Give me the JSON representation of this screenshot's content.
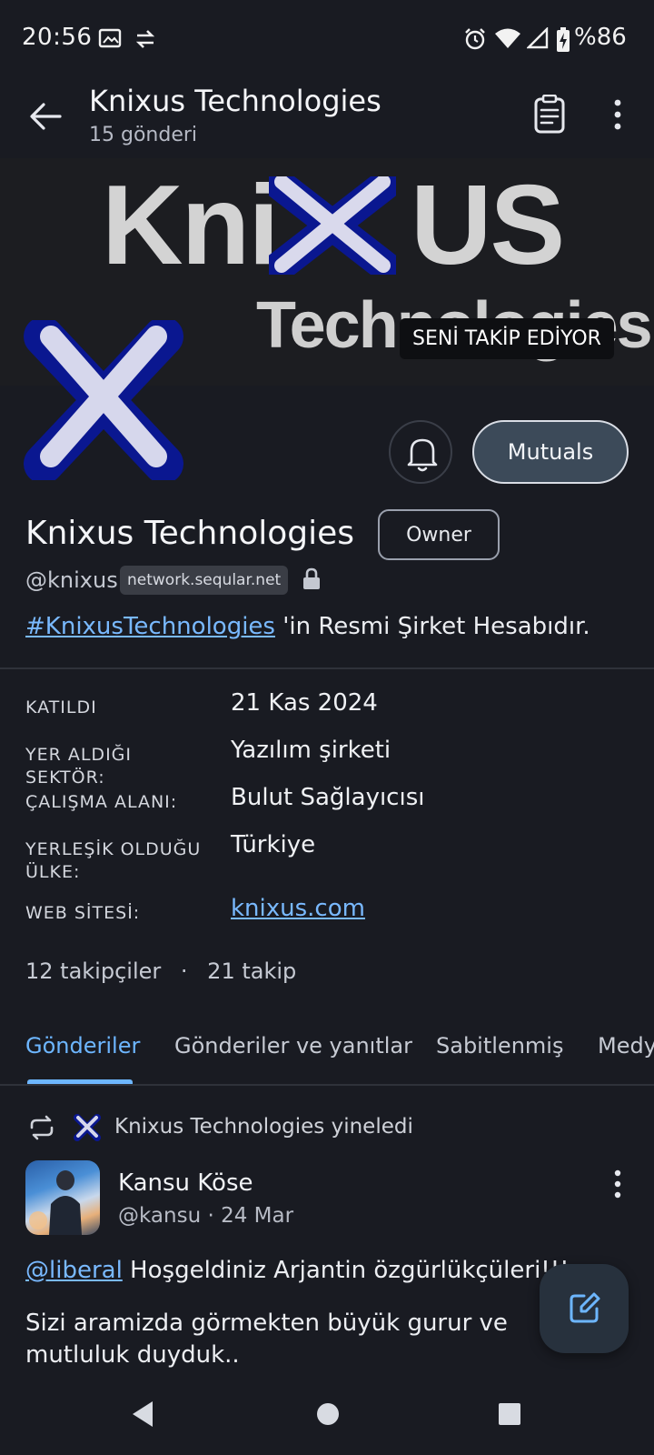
{
  "status_bar": {
    "time": "20:56",
    "battery": "%86"
  },
  "header": {
    "title": "Knixus Technologies",
    "subtitle": "15 gönderi"
  },
  "banner": {
    "brand_left": "Kni",
    "brand_right": "US",
    "brand_sub": "Technologies",
    "follows_you": "SENİ TAKİP EDİYOR"
  },
  "actions": {
    "mutuals_label": "Mutuals"
  },
  "profile": {
    "name": "Knixus Technologies",
    "role_badge": "Owner",
    "handle": "@knixus",
    "domain": "network.seqular.net",
    "bio_tag": "#KnixusTechnologies",
    "bio_rest": " 'in Resmi Şirket Hesabıdır."
  },
  "fields": [
    {
      "label": "KATILDI",
      "value": "21 Kas 2024"
    },
    {
      "label": "YER ALDIĞI SEKTÖR:",
      "value": "Yazılım şirketi"
    },
    {
      "label": "ÇALIŞMA ALANI:",
      "value": "Bulut Sağlayıcısı"
    },
    {
      "label": "YERLEŞİK OLDUĞU ÜLKE:",
      "value": "Türkiye"
    },
    {
      "label": "WEB SİTESİ:",
      "value": "knixus.com"
    }
  ],
  "stats": {
    "followers": "12 takipçiler",
    "separator": "·",
    "following": "21 takip"
  },
  "tabs": [
    {
      "label": "Gönderiler",
      "active": true
    },
    {
      "label": "Gönderiler ve yanıtlar",
      "active": false
    },
    {
      "label": "Sabitlenmiş",
      "active": false
    },
    {
      "label": "Medya",
      "active": false
    }
  ],
  "post": {
    "boost_text": "Knixus Technologies yineledi",
    "author_name": "Kansu Köse",
    "author_meta": "@kansu · 24 Mar",
    "mention": "@liberal",
    "line1_rest": " Hoşgeldiniz Arjantin özgürlükçüleri!!!",
    "line2": "Sizi aramizda görmekten büyük gurur ve mutluluk duyduk.."
  },
  "colors": {
    "background": "#191b22",
    "accent": "#6db6ff",
    "mutuals_bg": "#3c4a59",
    "logo_blue": "#0a1790"
  }
}
